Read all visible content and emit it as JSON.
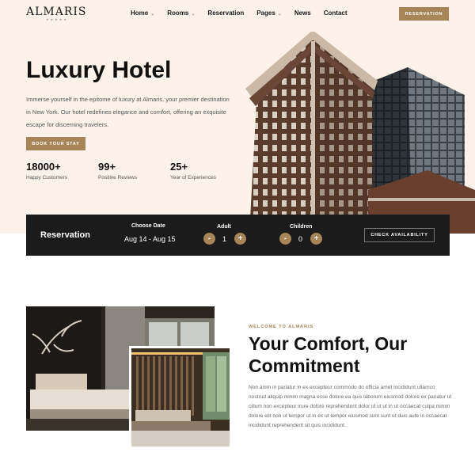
{
  "brand": {
    "name": "ALMARIS",
    "tagline": "★★★★★"
  },
  "nav": {
    "items": [
      {
        "label": "Home",
        "chevron": true
      },
      {
        "label": "Rooms",
        "chevron": true
      },
      {
        "label": "Reservation",
        "chevron": false
      },
      {
        "label": "Pages",
        "chevron": true
      },
      {
        "label": "News",
        "chevron": false
      },
      {
        "label": "Contact",
        "chevron": false
      }
    ],
    "cta": "RESERVATION"
  },
  "hero": {
    "title": "Luxury Hotel",
    "description": "Immerse yourself in the epitome of luxury at Almaris, your premier destination in New York. Our hotel redefines elegance and comfort, offering an exquisite escape for discerning travelers.",
    "button": "BOOK YOUR STAY",
    "stats": [
      {
        "value": "18000+",
        "label": "Happy Customers"
      },
      {
        "value": "99+",
        "label": "Positive Reviews"
      },
      {
        "value": "25+",
        "label": "Year of Experiences"
      }
    ]
  },
  "reservation": {
    "title": "Reservation",
    "date_label": "Choose Date",
    "date_value": "Aug 14 - Aug 15",
    "adult_label": "Adult",
    "adult_count": "1",
    "children_label": "Children",
    "children_count": "0",
    "minus": "-",
    "plus": "+",
    "button": "CHECK AVAILABILITY"
  },
  "about": {
    "eyebrow": "WELCOME TO ALMARIS",
    "title": "Your Comfort, Our Commitment",
    "body": "Non anim in pariatur in ex excepteur commodo do officia amet incididunt ullamco nostrud aliquip minim magna esse dolore ea quis laborum eiusmod dolore ex pariatur ut cillum non excepteur irure dolore reprehenderit dolor id ut ut in ut occaecat culpa minim dolore elit non ut tempor ut in ex ut tempor eiusmod sunt sunt ut duis aute in occaecat incididunt reprehenderit sit quis incididunt."
  },
  "colors": {
    "accent": "#a78559",
    "hero_bg": "#fdf2ea",
    "bar_bg": "#1b1b1b"
  },
  "icons": [
    "chevron-down-icon",
    "minus-icon",
    "plus-icon"
  ]
}
